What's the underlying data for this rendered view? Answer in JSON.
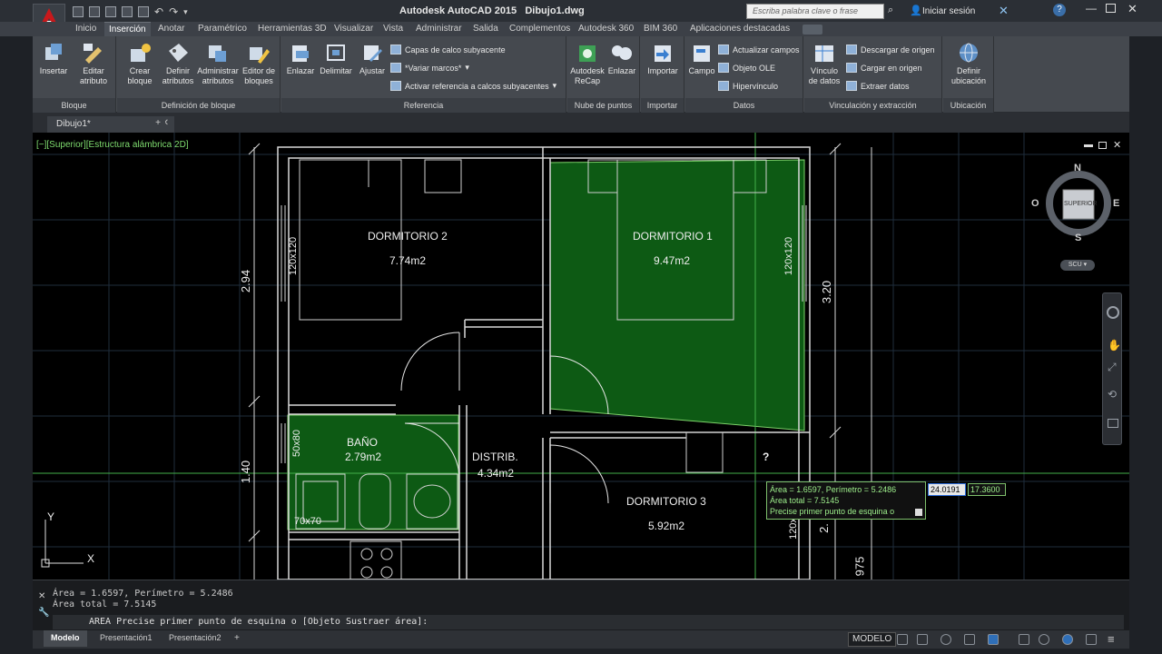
{
  "window": {
    "title": "Autodesk AutoCAD 2015   Dibujo1.dwg",
    "search_placeholder": "Escriba palabra clave o frase",
    "login_label": "Iniciar sesión"
  },
  "ribbon_tabs": [
    {
      "label": "Inicio"
    },
    {
      "label": "Inserción",
      "active": true
    },
    {
      "label": "Anotar"
    },
    {
      "label": "Paramétrico"
    },
    {
      "label": "Herramientas 3D"
    },
    {
      "label": "Visualizar"
    },
    {
      "label": "Vista"
    },
    {
      "label": "Administrar"
    },
    {
      "label": "Salida"
    },
    {
      "label": "Complementos"
    },
    {
      "label": "Autodesk 360"
    },
    {
      "label": "BIM 360"
    },
    {
      "label": "Aplicaciones destacadas"
    }
  ],
  "panels": {
    "bloque": {
      "title": "Bloque",
      "buttons": [
        "Insertar",
        "Editar atributo"
      ]
    },
    "definicion": {
      "title": "Definición de bloque",
      "buttons": [
        "Crear bloque",
        "Definir atributos",
        "Administrar atributos",
        "Editor de bloques"
      ]
    },
    "referencia": {
      "title": "Referencia",
      "buttons": [
        "Enlazar",
        "Delimitar",
        "Ajustar"
      ],
      "small": [
        "Capas de calco subyacente",
        "*Variar marcos*",
        "Activar referencia a calcos subyacentes"
      ]
    },
    "nube": {
      "title": "Nube de puntos",
      "buttons": [
        "Autodesk ReCap",
        "Enlazar"
      ]
    },
    "importar": {
      "title": "Importar",
      "buttons": [
        "Importar"
      ]
    },
    "datos": {
      "title": "Datos",
      "buttons": [
        "Campo"
      ],
      "small": [
        "Actualizar campos",
        "Objeto OLE",
        "Hipervínculo"
      ]
    },
    "vinculacion": {
      "title": "Vinculación y extracción",
      "buttons": [
        "Vínculo de datos"
      ],
      "small": [
        "Descargar de origen",
        "Cargar en origen",
        "Extraer  datos"
      ]
    },
    "ubicacion": {
      "title": "Ubicación",
      "buttons": [
        "Definir ubicación"
      ]
    }
  },
  "document_tab": "Dibujo1*",
  "viewport_label": "[−][Superior][Estructura alámbrica 2D]",
  "viewcube": {
    "top": "SUPERIOR",
    "n": "N",
    "s": "S",
    "e": "E",
    "w": "O",
    "ucs": "SCU"
  },
  "rooms": [
    {
      "name": "DORMITORIO 2",
      "area": "7.74m2"
    },
    {
      "name": "DORMITORIO 1",
      "area": "9.47m2"
    },
    {
      "name": "BAÑO",
      "area": "2.79m2"
    },
    {
      "name": "DISTRIB.",
      "area": "4.34m2"
    },
    {
      "name": "DORMITORIO 3",
      "area": "5.92m2"
    }
  ],
  "window_labels": [
    "120x120",
    "120x120",
    "50x80",
    "70x70",
    "120x"
  ],
  "dimensions": [
    "2.94",
    "3.20",
    "1.40",
    "2.",
    "975"
  ],
  "ucs_axes": {
    "x": "X",
    "y": "Y"
  },
  "area_tooltip": {
    "line1": "Área = 1.6597, Perímetro = 5.2486",
    "line2": "Área total = 7.5145",
    "line3": "Precise primer punto de esquina o",
    "x_value": "24.0191",
    "y_value": "17.3600",
    "cursor_marker": "?"
  },
  "command_history": [
    "Área = 1.6597, Perímetro = 5.2486",
    "Área total = 7.5145"
  ],
  "command_prompt": "AREA Precise primer punto de esquina o [Objeto Sustraer área]:",
  "layout_tabs": [
    {
      "label": "Modelo",
      "active": true
    },
    {
      "label": "Presentación1"
    },
    {
      "label": "Presentación2"
    }
  ],
  "status": {
    "space": "MODELO"
  },
  "colors": {
    "room_fill": "#0d5a14",
    "room_stroke": "#7ed36b",
    "accent_red": "#c8181b",
    "wall": "#d8d8d8"
  }
}
